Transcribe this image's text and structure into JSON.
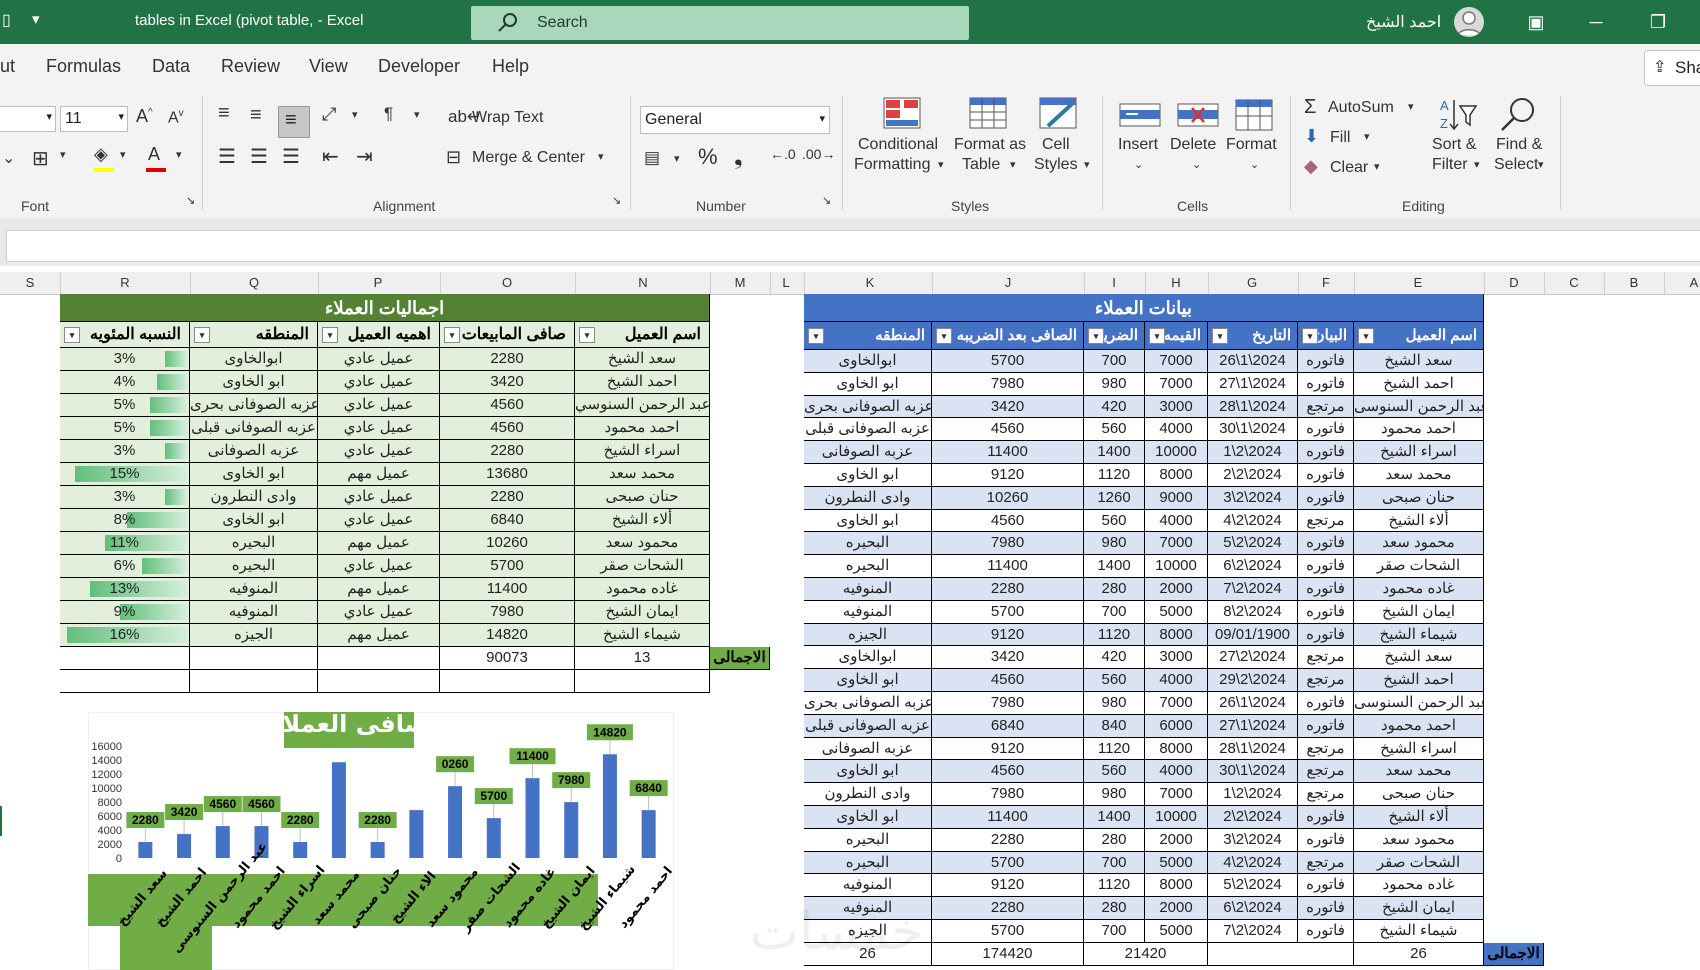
{
  "window": {
    "title": "tables in Excel (pivot table,  -  Excel",
    "search_placeholder": "Search",
    "user_name": "احمد الشيخ"
  },
  "menu": {
    "items": [
      "ut",
      "Formulas",
      "Data",
      "Review",
      "View",
      "Developer",
      "Help"
    ],
    "share": "Sha"
  },
  "ribbon": {
    "font_size": "11",
    "wrap_text": "Wrap Text",
    "merge_center": "Merge & Center",
    "number_format": "General",
    "conditional_formatting": [
      "Conditional",
      "Formatting"
    ],
    "format_as_table": [
      "Format as",
      "Table"
    ],
    "cell_styles": [
      "Cell",
      "Styles"
    ],
    "insert": "Insert",
    "delete": "Delete",
    "format": "Format",
    "autosum": "AutoSum",
    "fill": "Fill",
    "clear": "Clear",
    "sort_filter": [
      "Sort &",
      "Filter"
    ],
    "find_select": [
      "Find &",
      "Select"
    ],
    "groups": {
      "font": "Font",
      "alignment": "Alignment",
      "number": "Number",
      "styles": "Styles",
      "cells": "Cells",
      "editing": "Editing"
    }
  },
  "columns": [
    "S",
    "R",
    "Q",
    "P",
    "O",
    "N",
    "M",
    "L",
    "K",
    "J",
    "I",
    "H",
    "G",
    "F",
    "E",
    "D",
    "C",
    "B",
    "A"
  ],
  "summary_table": {
    "title": "اجماليات العملاء",
    "headers": [
      "اسم العميل",
      "صافى المابيعات",
      "اهميه العميل",
      "المنطقه",
      "النسبه المئويه"
    ],
    "rows": [
      [
        "سعد الشيخ",
        "2280",
        "عميل عادي",
        "ابوالخاوى",
        "3%"
      ],
      [
        "احمد الشيخ",
        "3420",
        "عميل عادي",
        "ابو الخاوى",
        "4%"
      ],
      [
        "عبد الرحمن السنوسي",
        "4560",
        "عميل عادي",
        "عزبه الصوفانى بحرى",
        "5%"
      ],
      [
        "احمد محمود",
        "4560",
        "عميل عادي",
        "عزبه الصوفانى قبلى",
        "5%"
      ],
      [
        "اسراء الشيخ",
        "2280",
        "عميل عادي",
        "عزبه الصوفانى",
        "3%"
      ],
      [
        "محمد سعد",
        "13680",
        "عميل مهم",
        "ابو الخاوى",
        "15%"
      ],
      [
        "حنان صبحى",
        "2280",
        "عميل عادي",
        "وادى النطرون",
        "3%"
      ],
      [
        "ألاء الشيخ",
        "6840",
        "عميل عادي",
        "ابو الخاوى",
        "8%"
      ],
      [
        "محمود سعد",
        "10260",
        "عميل مهم",
        "البحيره",
        "11%"
      ],
      [
        "الشحات صقر",
        "5700",
        "عميل عادي",
        "البحيره",
        "6%"
      ],
      [
        "غاده محمود",
        "11400",
        "عميل مهم",
        "المنوفيه",
        "13%"
      ],
      [
        "ايمان الشيخ",
        "7980",
        "عميل عادي",
        "المنوفيه",
        "9%"
      ],
      [
        "شيماء الشيخ",
        "14820",
        "عميل مهم",
        "الجيزه",
        "16%"
      ]
    ],
    "pct_values": [
      3,
      4,
      5,
      5,
      3,
      15,
      3,
      8,
      11,
      6,
      13,
      9,
      16
    ],
    "total_label": "الاجمالى",
    "total_count": "13",
    "total_sales": "90073"
  },
  "data_table": {
    "title": "بيانات العملاء",
    "headers": [
      "اسم العميل",
      "البيان",
      "التاريخ",
      "القيمه",
      "الضريبه",
      "الصافى بعد الضريبه",
      "المنطقه"
    ],
    "rows": [
      [
        "سعد الشيخ",
        "فاتوره",
        "26\\1\\2024",
        "7000",
        "700",
        "5700",
        "ابوالخاوى"
      ],
      [
        "احمد الشيخ",
        "فاتوره",
        "27\\1\\2024",
        "7000",
        "980",
        "7980",
        "ابو الخاوى"
      ],
      [
        "عبد الرحمن السنوسى",
        "مرتجع",
        "28\\1\\2024",
        "3000",
        "420",
        "3420",
        "عزبه الصوفانى بحرى"
      ],
      [
        "احمد محمود",
        "فاتوره",
        "30\\1\\2024",
        "4000",
        "560",
        "4560",
        "عزبه الصوفانى قبلى"
      ],
      [
        "اسراء الشيخ",
        "فاتوره",
        "1\\2\\2024",
        "10000",
        "1400",
        "11400",
        "عزبه الصوفانى"
      ],
      [
        "محمد سعد",
        "فاتوره",
        "2\\2\\2024",
        "8000",
        "1120",
        "9120",
        "ابو الخاوى"
      ],
      [
        "حنان صبحى",
        "فاتوره",
        "3\\2\\2024",
        "9000",
        "1260",
        "10260",
        "وادى النطرون"
      ],
      [
        "ألاء الشيخ",
        "مرتجع",
        "4\\2\\2024",
        "4000",
        "560",
        "4560",
        "ابو الخاوى"
      ],
      [
        "محمود سعد",
        "فاتوره",
        "5\\2\\2024",
        "7000",
        "980",
        "7980",
        "البحيره"
      ],
      [
        "الشحات صقر",
        "فاتوره",
        "6\\2\\2024",
        "10000",
        "1400",
        "11400",
        "البحيره"
      ],
      [
        "غاده محمود",
        "فاتوره",
        "7\\2\\2024",
        "2000",
        "280",
        "2280",
        "المنوفيه"
      ],
      [
        "ايمان الشيخ",
        "فاتوره",
        "8\\2\\2024",
        "5000",
        "700",
        "5700",
        "المنوفيه"
      ],
      [
        "شيماء الشيخ",
        "فاتوره",
        "09/01/1900",
        "8000",
        "1120",
        "9120",
        "الجيزه"
      ],
      [
        "سعد الشيخ",
        "مرتجع",
        "27\\2\\2024",
        "3000",
        "420",
        "3420",
        "ابوالخاوى"
      ],
      [
        "احمد الشيخ",
        "مرتجع",
        "29\\2\\2024",
        "4000",
        "560",
        "4560",
        "ابو الخاوى"
      ],
      [
        "عبد الرحمن السنوسى",
        "فاتوره",
        "26\\1\\2024",
        "7000",
        "980",
        "7980",
        "عزبه الصوفانى بحرى"
      ],
      [
        "احمد محمود",
        "فاتوره",
        "27\\1\\2024",
        "6000",
        "840",
        "6840",
        "عزبه الصوفانى قبلى"
      ],
      [
        "اسراء الشيخ",
        "مرتجع",
        "28\\1\\2024",
        "8000",
        "1120",
        "9120",
        "عزبه الصوفانى"
      ],
      [
        "محمد سعد",
        "مرتجع",
        "30\\1\\2024",
        "4000",
        "560",
        "4560",
        "ابو الخاوى"
      ],
      [
        "حنان صبحى",
        "مرتجع",
        "1\\2\\2024",
        "7000",
        "980",
        "7980",
        "وادى النطرون"
      ],
      [
        "ألاء الشيخ",
        "فاتوره",
        "2\\2\\2024",
        "10000",
        "1400",
        "11400",
        "ابو الخاوى"
      ],
      [
        "محمود سعد",
        "فاتوره",
        "3\\2\\2024",
        "2000",
        "280",
        "2280",
        "البحيره"
      ],
      [
        "الشحات صقر",
        "مرتجع",
        "4\\2\\2024",
        "5000",
        "700",
        "5700",
        "البحيره"
      ],
      [
        "غاده محمود",
        "فاتوره",
        "5\\2\\2024",
        "8000",
        "1120",
        "9120",
        "المنوفيه"
      ],
      [
        "ايمان الشيخ",
        "فاتوره",
        "6\\2\\2024",
        "2000",
        "280",
        "2280",
        "المنوفيه"
      ],
      [
        "شيماء الشيخ",
        "فاتوره",
        "7\\2\\2024",
        "5000",
        "700",
        "5700",
        "الجيزه"
      ]
    ],
    "total_label": "الاجمالى",
    "total_count": "26",
    "total_tax": "21420",
    "total_net": "174420"
  },
  "chart_data": {
    "type": "bar",
    "title": "صافى العملاء",
    "categories": [
      "سعد الشيخ",
      "احمد الشيخ",
      "عبد الرحمن السنوسى",
      "احمد محمود",
      "اسراء الشيخ",
      "محمد سعد",
      "حنان صبحى",
      "الاء الشيخ",
      "محمود سعد",
      "الشحات صقر",
      "غاده محمود",
      "ايمان الشيخ",
      "شيماء الشيخ",
      "احمد محمود"
    ],
    "values": [
      2280,
      3420,
      4560,
      4560,
      2280,
      13680,
      2280,
      6840,
      10260,
      5700,
      11400,
      7980,
      14820,
      6840
    ],
    "value_labels": [
      "2280",
      "3420",
      "4560",
      "4560",
      "2280",
      "",
      "2280",
      "",
      "0260",
      "5700",
      "11400",
      "7980",
      "14820",
      "6840"
    ],
    "yticks": [
      "16000",
      "14000",
      "12000",
      "10000",
      "8000",
      "6000",
      "4000",
      "2000",
      "0"
    ],
    "ylim": [
      0,
      16000
    ],
    "bar_color": "#4472c4",
    "label_bg": "#70ad47"
  },
  "colors": {
    "excel_green": "#217346",
    "summary_header": "#548235",
    "data_header": "#4472c4",
    "row_fill": "#e2efda"
  }
}
